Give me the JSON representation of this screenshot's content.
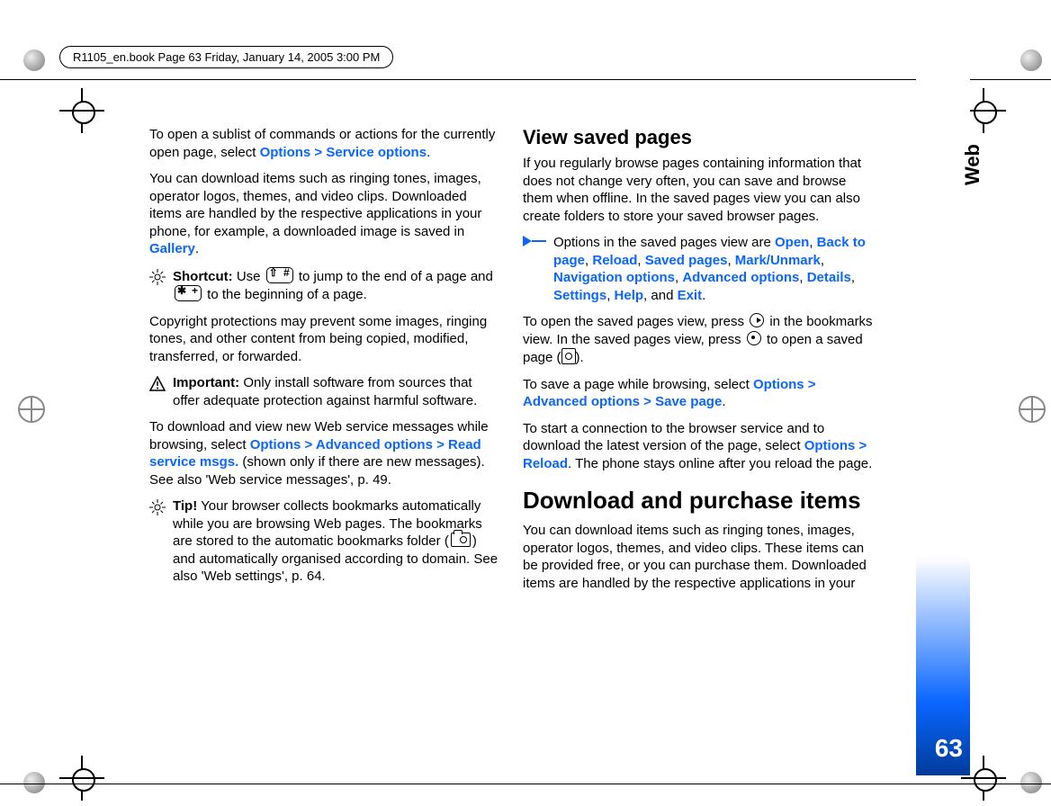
{
  "header": {
    "running_head": "R1105_en.book  Page 63  Friday, January 14, 2005  3:00 PM"
  },
  "side": {
    "section": "Web",
    "page_number": "63"
  },
  "leftcol": {
    "p1a": "To open a sublist of commands or actions for the currently open page, select ",
    "p1_link": "Options > Service options",
    "p1b": ".",
    "p2a": "You can download items such as ringing tones, images, operator logos, themes, and video clips. Downloaded items are handled by the respective applications in your phone, for example, a downloaded image is saved in ",
    "p2_link": "Gallery",
    "p2b": ".",
    "shortcut_label": "Shortcut:",
    "shortcut_a": " Use ",
    "shortcut_b": " to jump to the end of a page and ",
    "shortcut_c": " to the beginning of a page.",
    "p3": "Copyright protections may prevent some images, ringing tones, and other content from being copied, modified, transferred, or forwarded.",
    "important_label": "Important:",
    "important_body": " Only install software from sources that offer adequate protection against harmful software.",
    "p4a": "To download and view new Web service messages while browsing, select ",
    "p4_link": "Options > Advanced options > Read service msgs.",
    "p4b": " (shown only if there are new messages). See also 'Web service messages', p. 49.",
    "tip_label": "Tip!",
    "tip_a": " Your browser collects bookmarks automatically while you are browsing Web pages. The bookmarks are stored to the automatic bookmarks folder (",
    "tip_b": ") and automatically organised according to domain. See also 'Web settings', p. 64."
  },
  "rightcol": {
    "h2": "View saved pages",
    "p1": "If you regularly browse pages containing information that does not change very often, you can save and browse them when offline. In the saved pages view you can also create folders to store your saved browser pages.",
    "opt_a": "Options in the saved pages view are ",
    "links": {
      "open": "Open",
      "back": "Back to page",
      "reload": "Reload",
      "saved": "Saved pages",
      "mark": "Mark/Unmark",
      "nav": "Navigation options",
      "adv": "Advanced options",
      "details": "Details",
      "settings": "Settings",
      "help": "Help",
      "exit": "Exit"
    },
    "and": ", and ",
    "comma": ", ",
    "period": ".",
    "p2a": "To open the saved pages view, press ",
    "p2b": " in the bookmarks view. In the saved pages view, press ",
    "p2c": " to open a saved page (",
    "p2d": ").",
    "p3a": "To save a page while browsing, select ",
    "p3_link": "Options > Advanced options > Save page",
    "p3b": ".",
    "p4a": "To start a connection to the browser service and to download the latest version of the page, select ",
    "p4_link": "Options > Reload",
    "p4b": ". The phone stays online after you reload the page.",
    "h1": "Download and purchase items",
    "p5": "You can download items such as ringing tones, images, operator logos, themes, and video clips. These items can be provided free, or you can purchase them. Downloaded items are handled by the respective applications in your"
  }
}
